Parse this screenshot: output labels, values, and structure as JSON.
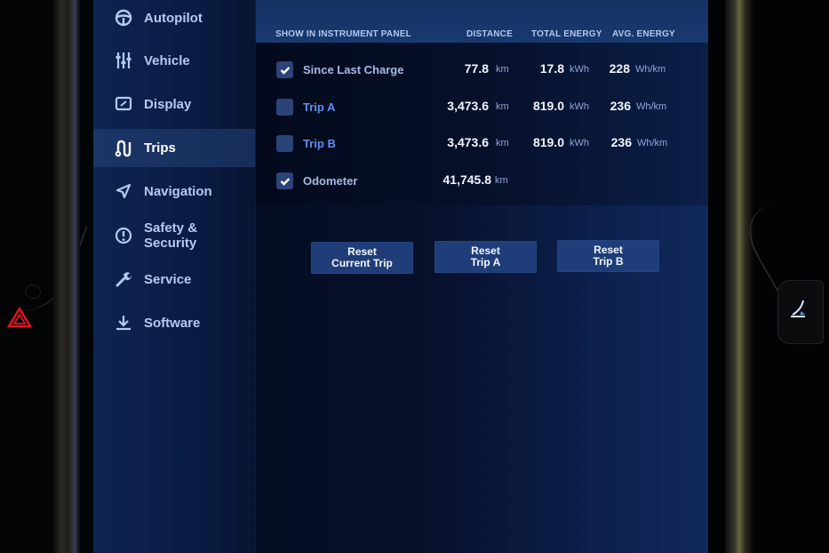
{
  "sidebar": {
    "items": [
      {
        "label": "Autopilot",
        "icon": "steering-wheel-icon",
        "active": false
      },
      {
        "label": "Vehicle",
        "icon": "sliders-icon",
        "active": false
      },
      {
        "label": "Display",
        "icon": "display-icon",
        "active": false
      },
      {
        "label": "Trips",
        "icon": "trips-route-icon",
        "active": true
      },
      {
        "label": "Navigation",
        "icon": "navigation-arrow-icon",
        "active": false
      },
      {
        "label": "Safety & Security",
        "icon": "exclamation-circle-icon",
        "active": false
      },
      {
        "label": "Service",
        "icon": "wrench-icon",
        "active": false
      },
      {
        "label": "Software",
        "icon": "download-icon",
        "active": false
      }
    ]
  },
  "trips": {
    "headers": {
      "show": "SHOW IN INSTRUMENT PANEL",
      "distance": "DISTANCE",
      "total_energy": "TOTAL ENERGY",
      "avg_energy": "AVG. ENERGY"
    },
    "rows": [
      {
        "label": "Since Last Charge",
        "checked": true,
        "distance": "77.8",
        "distance_unit": "km",
        "energy": "17.8",
        "energy_unit": "kWh",
        "avg": "228",
        "avg_unit": "Wh/km"
      },
      {
        "label": "Trip A",
        "checked": false,
        "distance": "3,473.6",
        "distance_unit": "km",
        "energy": "819.0",
        "energy_unit": "kWh",
        "avg": "236",
        "avg_unit": "Wh/km"
      },
      {
        "label": "Trip B",
        "checked": false,
        "distance": "3,473.6",
        "distance_unit": "km",
        "energy": "819.0",
        "energy_unit": "kWh",
        "avg": "236",
        "avg_unit": "Wh/km"
      },
      {
        "label": "Odometer",
        "checked": true,
        "distance": "41,745.8",
        "distance_unit": "km"
      }
    ],
    "buttons": [
      {
        "line1": "Reset",
        "line2": "Current Trip"
      },
      {
        "line1": "Reset",
        "line2": "Trip A"
      },
      {
        "line1": "Reset",
        "line2": "Trip B"
      }
    ]
  },
  "colors": {
    "accent_link": "#5f8ff0",
    "hazard": "#e0141c"
  }
}
